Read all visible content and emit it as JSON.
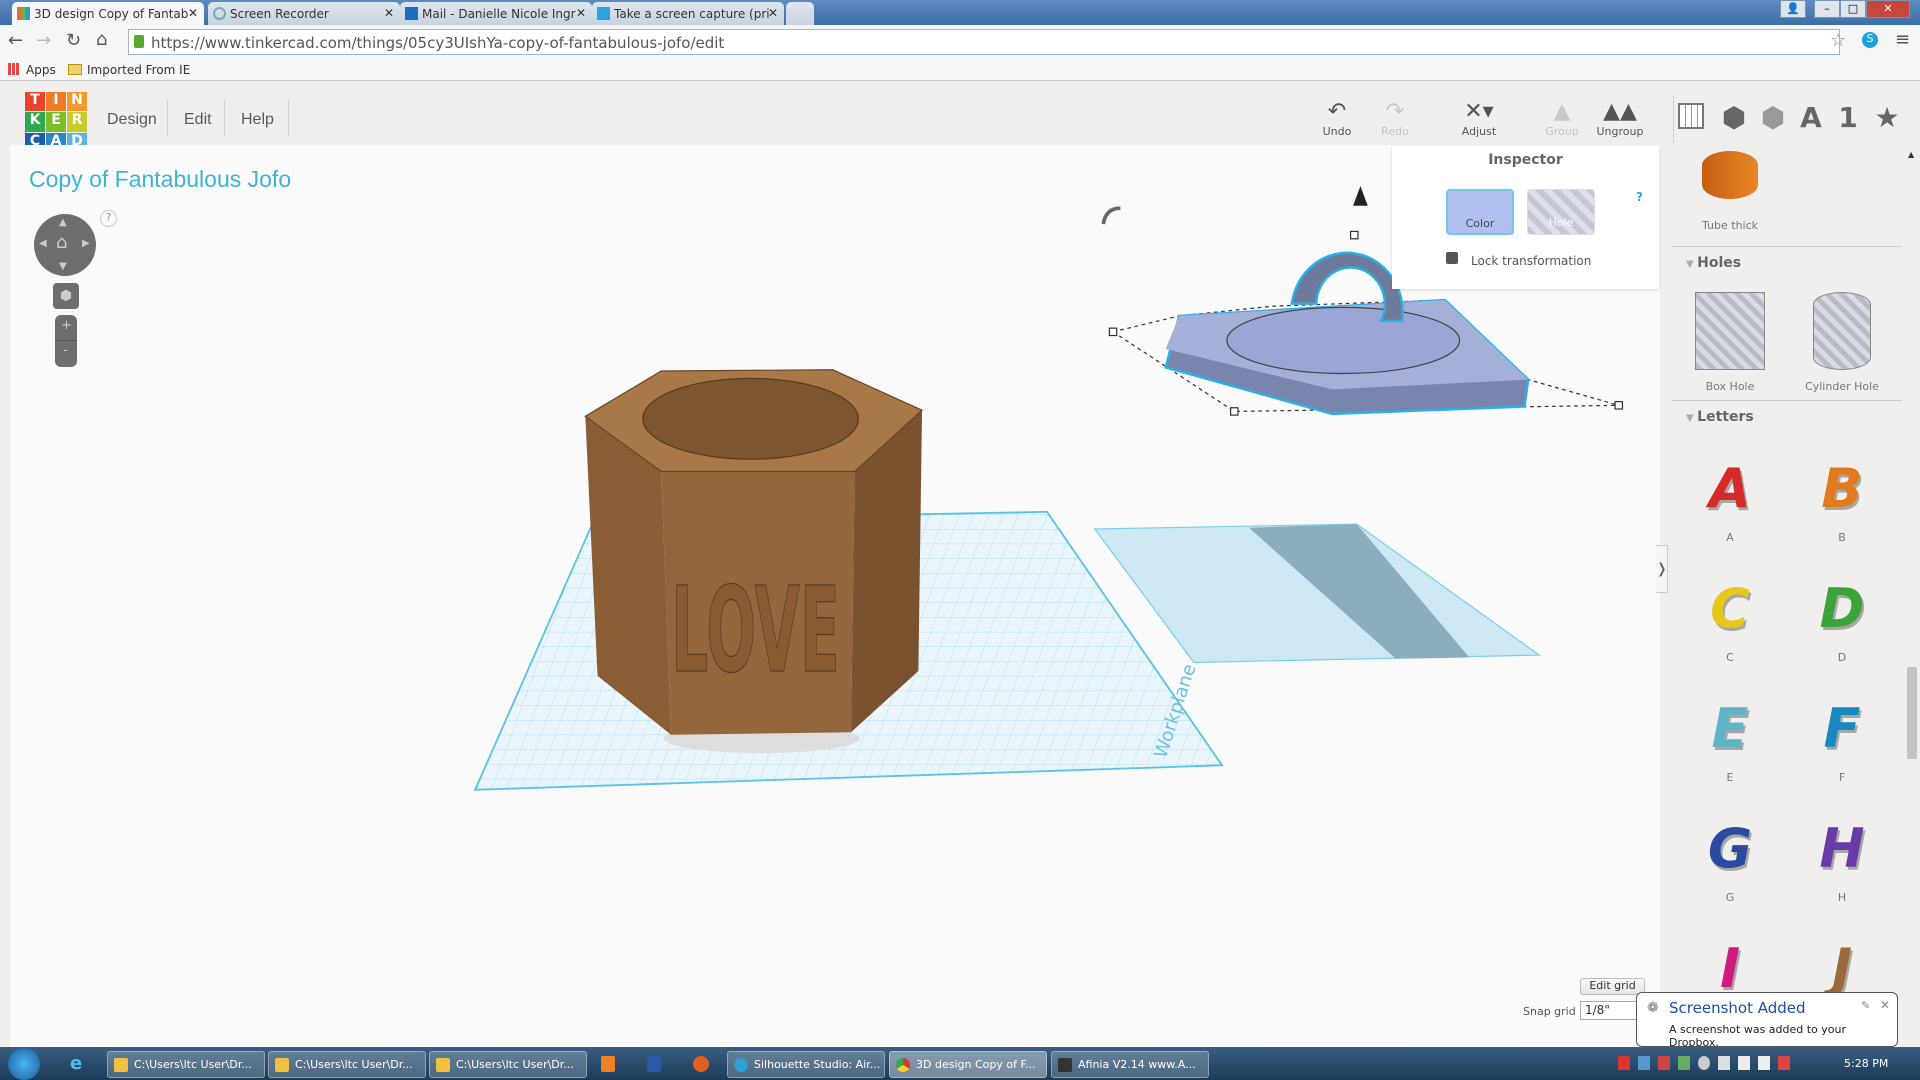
{
  "browser": {
    "tabs": [
      {
        "label": "3D design Copy of Fantab",
        "active": true
      },
      {
        "label": "Screen Recorder"
      },
      {
        "label": "Mail - Danielle Nicole Ingr"
      },
      {
        "label": "Take a screen capture (pri"
      }
    ],
    "url": "https://www.tinkercad.com/things/05cy3UIshYa-copy-of-fantabulous-jofo/edit",
    "bookmarks": [
      "Apps",
      "Imported From IE"
    ]
  },
  "app": {
    "logo": [
      "T",
      "I",
      "N",
      "K",
      "E",
      "R",
      "C",
      "A",
      "D"
    ],
    "menu": [
      "Design",
      "Edit",
      "Help"
    ],
    "toolbar": {
      "undo": "Undo",
      "redo": "Redo",
      "adjust": "Adjust",
      "group": "Group",
      "ungroup": "Ungroup"
    },
    "view_icons": [
      "workplane-icon",
      "box-icon",
      "hole-box-icon",
      "A",
      "1",
      "star-icon"
    ],
    "design_title": "Copy of Fantabulous Jofo",
    "help": "?",
    "zoom_in": "+",
    "zoom_out": "-",
    "workplane_label": "Workplane",
    "model_text": "LOVE",
    "inspector": {
      "title": "Inspector",
      "color": "Color",
      "hole": "Hole",
      "help": "?",
      "lock": "Lock transformation",
      "selected_color": "#b0bff0"
    },
    "sidebar": {
      "top_item": "Tube thick",
      "holes_title": "Holes",
      "holes": [
        "Box Hole",
        "Cylinder Hole"
      ],
      "letters_title": "Letters",
      "letters": [
        {
          "l": "A",
          "c": "#d42a2a"
        },
        {
          "l": "B",
          "c": "#e07a1c"
        },
        {
          "l": "C",
          "c": "#e6c81a"
        },
        {
          "l": "D",
          "c": "#3aa33a"
        },
        {
          "l": "E",
          "c": "#5fb5c5"
        },
        {
          "l": "F",
          "c": "#1788c0"
        },
        {
          "l": "G",
          "c": "#2a4ba0"
        },
        {
          "l": "H",
          "c": "#6a3aa8"
        },
        {
          "l": "I",
          "c": "#d01a80"
        },
        {
          "l": "J",
          "c": "#9a6a3a"
        }
      ]
    },
    "edit_grid": "Edit grid",
    "snap_label": "Snap grid",
    "snap_value": "1/8\""
  },
  "notification": {
    "title": "Screenshot Added",
    "body": "A screenshot was added to your Dropbox."
  },
  "taskbar": {
    "items": [
      "C:\\Users\\ltc User\\Dr...",
      "C:\\Users\\ltc User\\Dr...",
      "C:\\Users\\ltc User\\Dr...",
      "Silhouette Studio: Air...",
      "3D design Copy of F...",
      "Afinia  V2.14  www.A..."
    ],
    "time": "5:28 PM"
  }
}
